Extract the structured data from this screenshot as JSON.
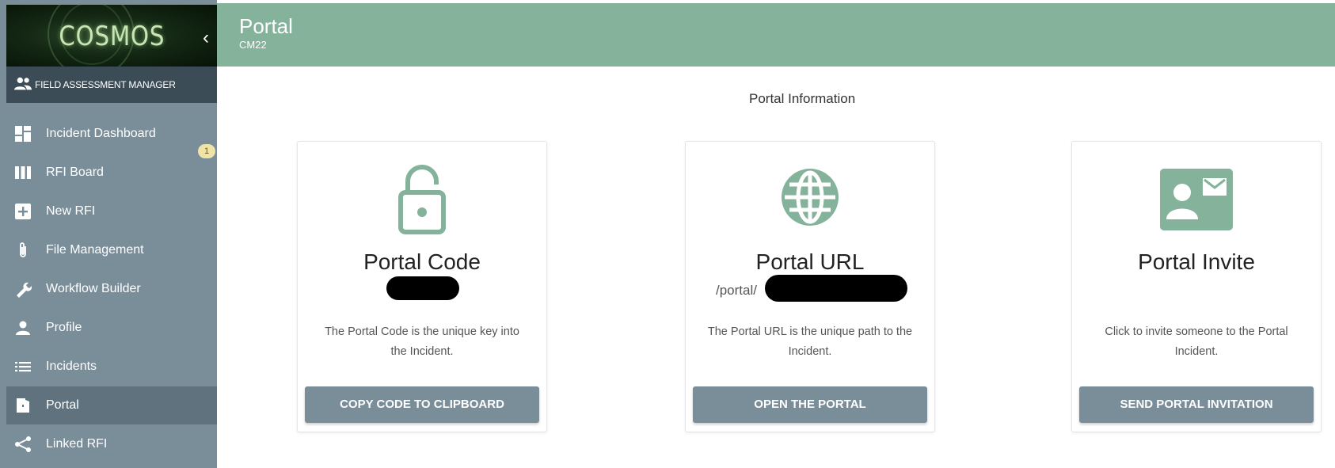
{
  "sidebar": {
    "logo_text": "COSMOS",
    "collapse_icon": "chevron-left-icon",
    "role_icon": "group-icon",
    "role": "FIELD ASSESSMENT MANAGER",
    "items": [
      {
        "label": "Incident Dashboard",
        "icon": "dashboard-icon",
        "badge": "1"
      },
      {
        "label": "RFI Board",
        "icon": "columns-icon"
      },
      {
        "label": "New RFI",
        "icon": "plus-box-icon"
      },
      {
        "label": "File Management",
        "icon": "paperclip-icon"
      },
      {
        "label": "Workflow Builder",
        "icon": "wrench-icon"
      },
      {
        "label": "Profile",
        "icon": "person-icon"
      },
      {
        "label": "Incidents",
        "icon": "list-icon"
      },
      {
        "label": "Portal",
        "icon": "door-icon",
        "active": true
      },
      {
        "label": "Linked RFI",
        "icon": "share-icon"
      }
    ]
  },
  "header": {
    "title": "Portal",
    "subtitle": "CM22"
  },
  "main": {
    "section_title": "Portal Information",
    "cards": [
      {
        "icon": "lock-open-icon",
        "title": "Portal Code",
        "description": "The Portal Code is the unique key into the Incident.",
        "button": "COPY CODE TO CLIPBOARD"
      },
      {
        "icon": "globe-icon",
        "title": "Portal URL",
        "url_prefix": "/portal/",
        "description": "The Portal URL is the unique path to the Incident.",
        "button": "OPEN THE PORTAL"
      },
      {
        "icon": "contact-mail-icon",
        "title": "Portal Invite",
        "description": "Click to invite someone to the Portal Incident.",
        "button": "SEND PORTAL INVITATION"
      }
    ]
  },
  "colors": {
    "header_bg": "#84b29b",
    "icon_green": "#84b29b",
    "sidebar_bg": "#7a8e9a",
    "sidebar_active": "#5f727e",
    "role_bar": "#3b4c57",
    "button_bg": "#7a8e9a"
  }
}
